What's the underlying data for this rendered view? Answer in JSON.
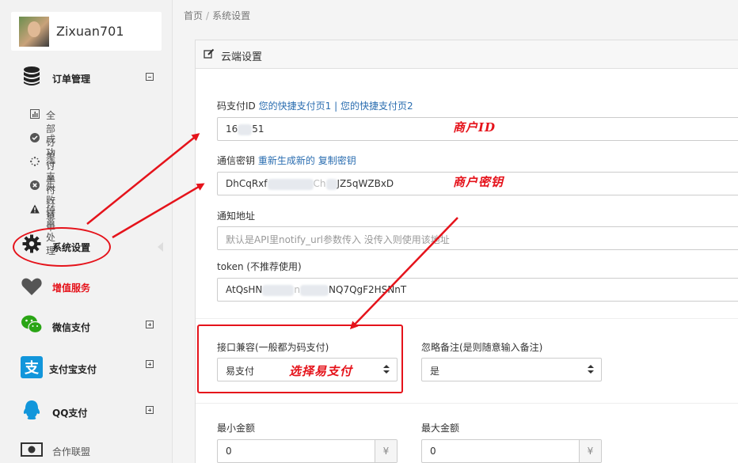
{
  "user": {
    "name": "Zixuan701"
  },
  "sidebar": {
    "order_mgmt": {
      "label": "订单管理"
    },
    "sub_items": [
      {
        "label": "全部订单",
        "icon": "bar-chart-icon"
      },
      {
        "label": "成功订单",
        "icon": "check-circle-icon"
      },
      {
        "label": "待支付订单",
        "icon": "spinner-icon"
      },
      {
        "label": "失败订单",
        "icon": "x-circle-icon"
      },
      {
        "label": "掉单处理",
        "icon": "warning-icon"
      }
    ],
    "settings": {
      "label": "系统设置"
    },
    "value_added": {
      "label": "增值服务",
      "color": "#e5131b"
    },
    "wechat": {
      "label": "微信支付"
    },
    "alipay": {
      "label": "支付宝支付"
    },
    "qq": {
      "label": "QQ支付"
    },
    "alliance": {
      "label": "合作联盟"
    }
  },
  "breadcrumb": {
    "home": "首页",
    "sep": "/",
    "current": "系统设置"
  },
  "panel": {
    "title": "云端设置",
    "merchant_id": {
      "label": "码支付ID",
      "link1": "您的快捷支付页1",
      "link_sep": "|",
      "link2": "您的快捷支付页2",
      "value_start": "16",
      "value_end": "51"
    },
    "secret": {
      "label": "通信密钥",
      "regen": "重新生成新的",
      "copy": "复制密钥",
      "value_start": "DhCqRxf",
      "value_mid": "Ch",
      "value_end": "JZ5qWZBxD"
    },
    "notify": {
      "label": "通知地址",
      "placeholder": "默认是API里notify_url参数传入 没传入则使用该地址"
    },
    "token": {
      "label": "token (不推荐使用)",
      "value_start": "AtQsHN",
      "value_mid": "n",
      "value_end": "NQ7QgF2HSNnT"
    },
    "compat": {
      "label": "接口兼容(一般都为码支付)",
      "value": "易支付"
    },
    "ignore_note": {
      "label": "忽略备注(是则随意输入备注)",
      "value": "是"
    },
    "min_amount": {
      "label": "最小金额",
      "value": "0",
      "unit": "¥"
    },
    "max_amount": {
      "label": "最大金额",
      "value": "0",
      "unit": "¥"
    }
  },
  "annotations": {
    "merchant_id": "商户ID",
    "secret": "商户密钥",
    "select_pay": "选择易支付",
    "color": "#e5131b"
  }
}
